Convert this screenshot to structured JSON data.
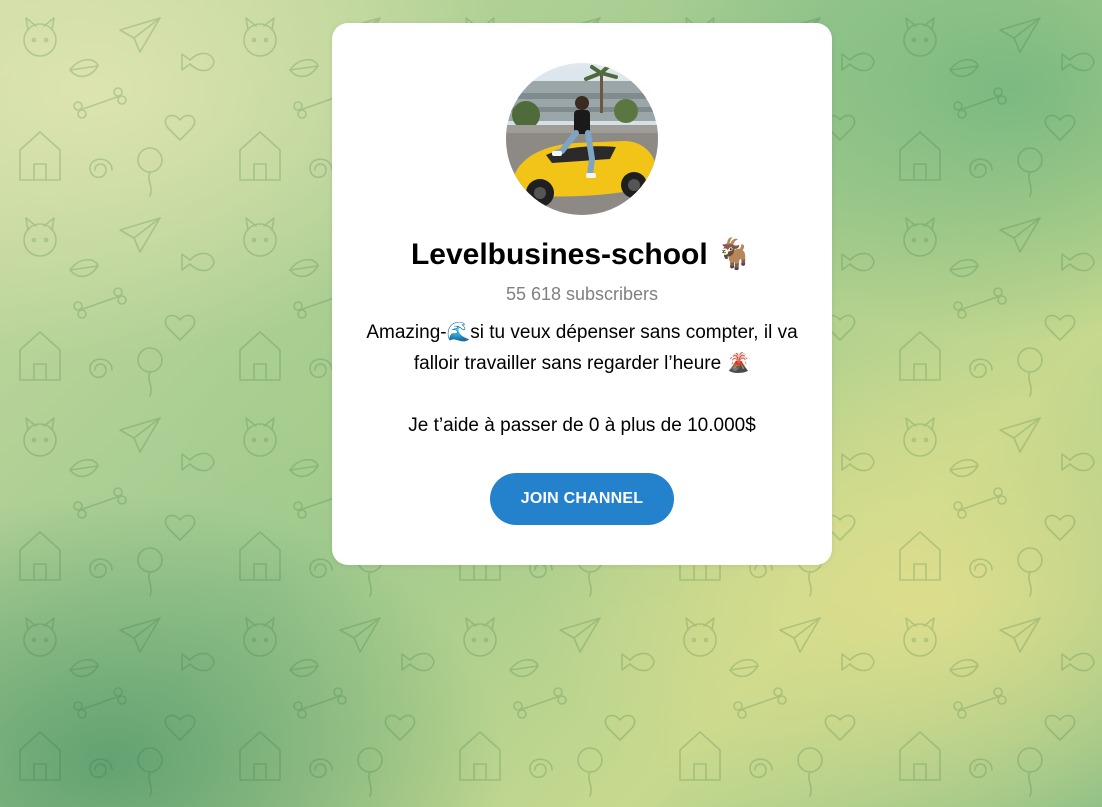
{
  "channel": {
    "name": "Levelbusines-school",
    "name_emoji": "🐐",
    "subscribers": "55 618 subscribers",
    "description_line1": "Amazing-🌊si tu veux dépenser sans compter, il va",
    "description_line2": "falloir travailler sans regarder l’heure 🌋",
    "description_line3": "Je t’aide à passer de 0 à plus de 10.000$",
    "join_label": "JOIN CHANNEL",
    "avatar_icon": "channel-avatar-photo"
  },
  "colors": {
    "accent": "#2481cc",
    "card": "#ffffff",
    "muted_text": "#808080"
  }
}
